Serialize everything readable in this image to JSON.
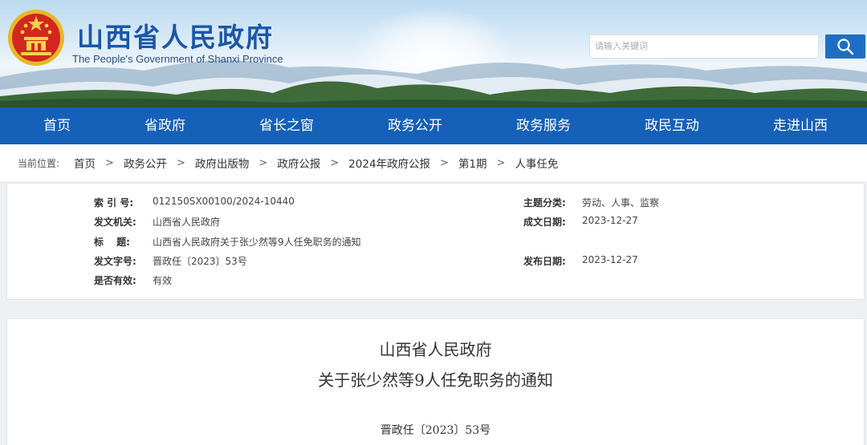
{
  "header": {
    "site_title": "山西省人民政府",
    "site_subtitle": "The People's Government of Shanxi Province",
    "search_placeholder": "请输入关键词"
  },
  "colors": {
    "brand_blue": "#1b57a8",
    "nav_blue": "#1560b8",
    "search_button": "#1e6fc3"
  },
  "icons": {
    "emblem": "national-emblem-icon",
    "search": "search-icon"
  },
  "nav": {
    "items": [
      {
        "label": "首页"
      },
      {
        "label": "省政府"
      },
      {
        "label": "省长之窗"
      },
      {
        "label": "政务公开"
      },
      {
        "label": "政务服务"
      },
      {
        "label": "政民互动"
      },
      {
        "label": "走进山西"
      }
    ]
  },
  "breadcrumb": {
    "label": "当前位置:",
    "items": [
      {
        "label": "首页"
      },
      {
        "label": "政务公开"
      },
      {
        "label": "政府出版物"
      },
      {
        "label": "政府公报"
      },
      {
        "label": "2024年政府公报"
      },
      {
        "label": "第1期"
      },
      {
        "label": "人事任免"
      }
    ],
    "separator": ">"
  },
  "meta": {
    "index_key": "索 引 号:",
    "index_value": "012150SX00100/2024-10440",
    "issuer_key": "发文机关:",
    "issuer_value": "山西省人民政府",
    "title_key": "标　 题:",
    "title_value": "山西省人民政府关于张少然等9人任免职务的通知",
    "docnum_key": "发文字号:",
    "docnum_value": "晋政任〔2023〕53号",
    "valid_key": "是否有效:",
    "valid_value": "有效",
    "category_key": "主题分类:",
    "category_value": "劳动、人事、监察",
    "created_key": "成文日期:",
    "created_value": "2023-12-27",
    "published_key": "发布日期:",
    "published_value": "2023-12-27"
  },
  "document": {
    "issuer": "山西省人民政府",
    "title": "关于张少然等9人任免职务的通知",
    "number": "晋政任〔2023〕53号"
  }
}
